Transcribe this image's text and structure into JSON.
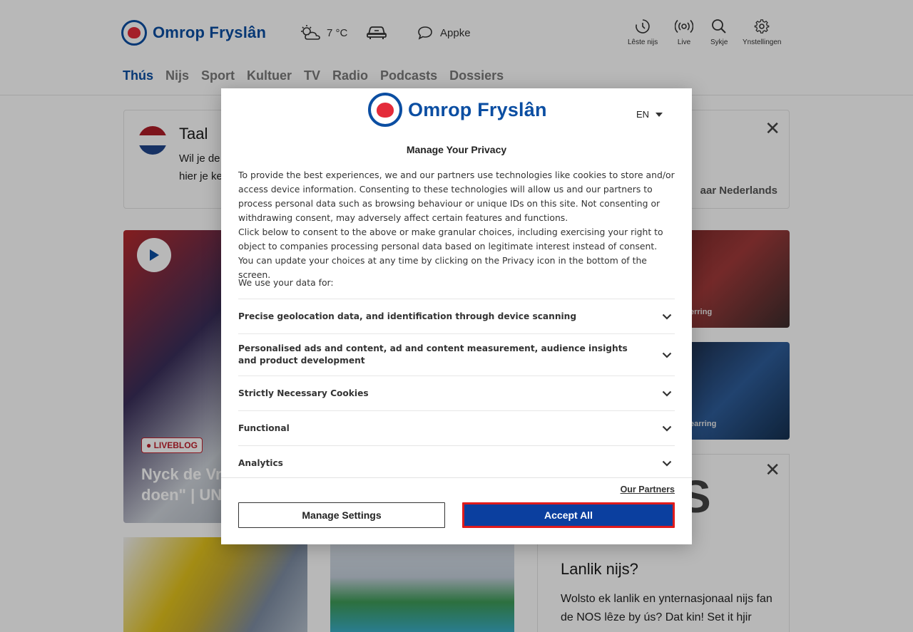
{
  "header": {
    "brand": "Omrop Fryslân",
    "weather": "7 °C",
    "appke": "Appke",
    "tools": [
      {
        "label": "Lêste nijs",
        "icon": "clock-icon"
      },
      {
        "label": "Live",
        "icon": "broadcast-icon"
      },
      {
        "label": "Sykje",
        "icon": "search-icon"
      },
      {
        "label": "Ynstellingen",
        "icon": "gear-icon"
      }
    ],
    "nav": [
      "Thús",
      "Nijs",
      "Sport",
      "Kultuer",
      "TV",
      "Radio",
      "Podcasts",
      "Dossiers"
    ]
  },
  "taal": {
    "title": "Taal",
    "text_line1": "Wil je de",
    "text_line2": "hier je ke",
    "link": "aar Nederlands"
  },
  "hero": {
    "badge": "LIVEBLOG",
    "title_line1": "Nyck de Vr",
    "title_line2": "doen\" | UNI"
  },
  "side_cards": [
    "erring",
    "earring"
  ],
  "nos": {
    "letters": "S",
    "title": "Lanlik nijs?",
    "text": "Wolsto ek lanlik en ynternasjonaal nijs fan de NOS lêze by ús? Dat kin! Set it hjir"
  },
  "consent": {
    "brand": "Omrop Fryslân",
    "language": "EN",
    "heading": "Manage Your Privacy",
    "paragraph1": "To provide the best experiences, we and our partners use technologies like cookies to store and/or access device information. Consenting to these technologies will allow us and our partners to process personal data such as browsing behaviour or unique IDs on this site. Not consenting or withdrawing consent, may adversely affect certain features and functions.",
    "paragraph2": "Click below to consent to the above or make granular choices, including exercising your right to object to companies processing personal data based on legitimate interest instead of consent. You can update your choices at any time by clicking on the Privacy icon in the bottom of the screen.",
    "use_label": "We use your data for:",
    "purposes": [
      "Precise geolocation data, and identification through device scanning",
      "Personalised ads and content, ad and content measurement, audience insights and product development",
      "Strictly Necessary Cookies",
      "Functional",
      "Analytics"
    ],
    "partners_link": "Our Partners",
    "manage_button": "Manage Settings",
    "accept_button": "Accept All",
    "colors": {
      "brand": "#0b4ea2",
      "accept": "#0b3f9f",
      "highlight": "#e01b1b"
    }
  }
}
